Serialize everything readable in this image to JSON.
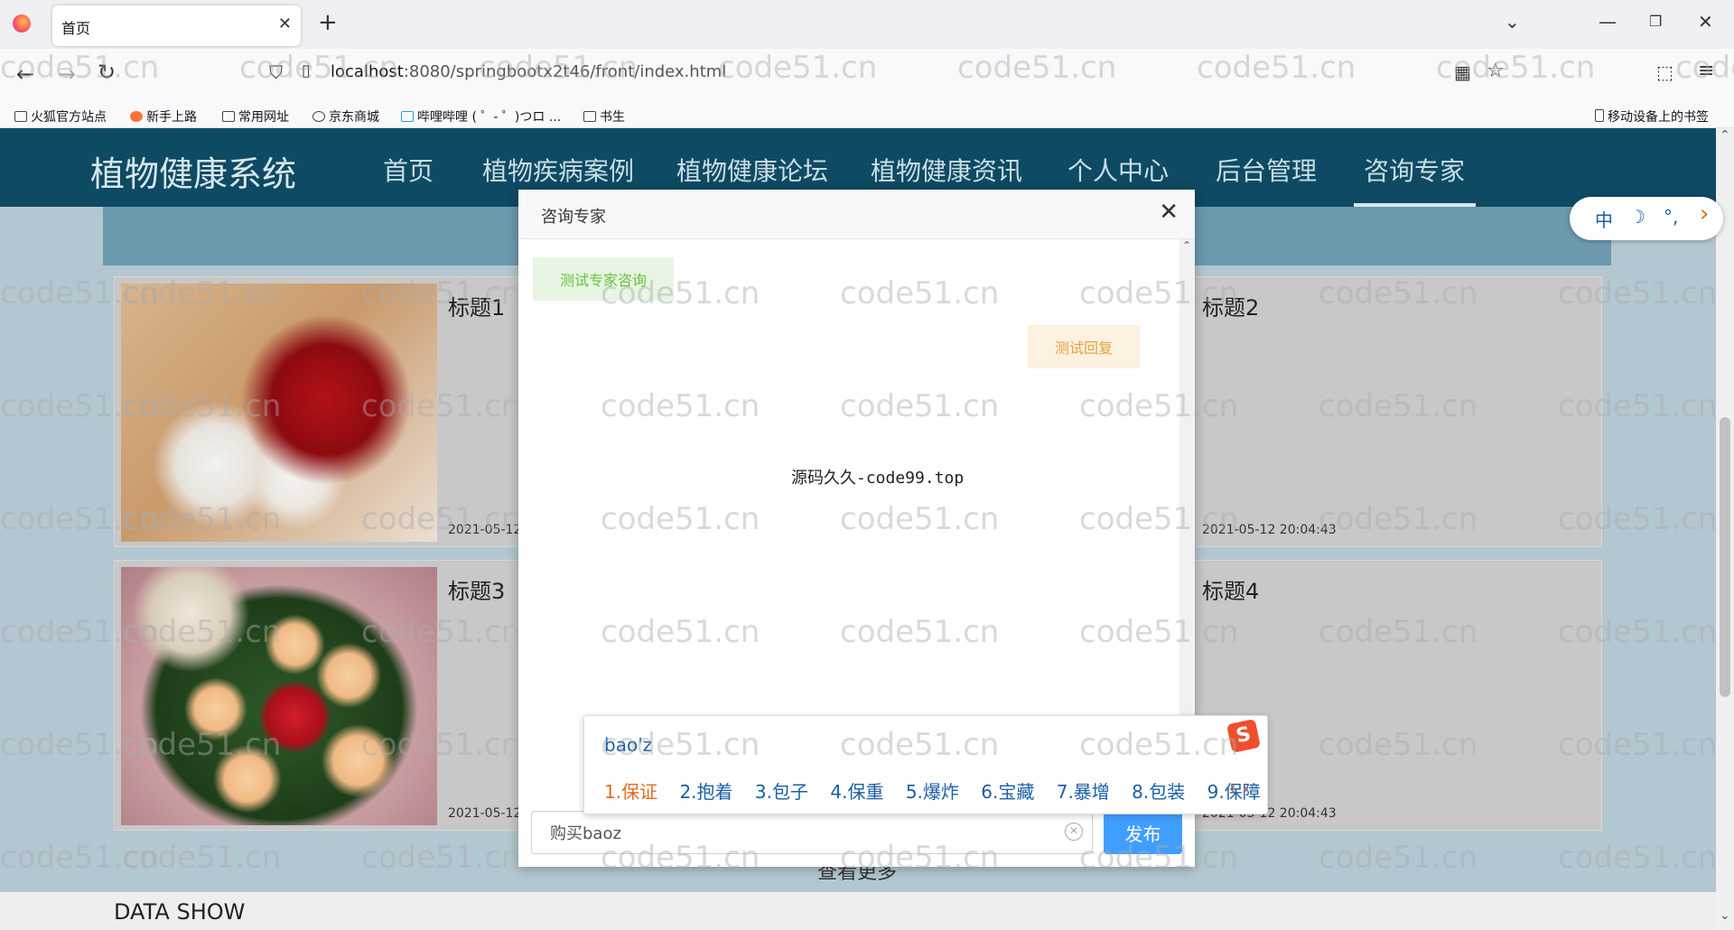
{
  "browser": {
    "tab_title": "首页",
    "tab_close": "✕",
    "new_tab": "+",
    "url_host": "localhost",
    "url_path": ":8080/springbootx2t46/front/index.html",
    "bookmarks": [
      "火狐官方站点",
      "新手上路",
      "常用网址",
      "京东商城",
      "哔哩哔哩 ( ゜- ゜)つロ ...",
      "书生"
    ],
    "mobile_bookmarks": "移动设备上的书签"
  },
  "site": {
    "title": "植物健康系统",
    "nav": [
      "首页",
      "植物疾病案例",
      "植物健康论坛",
      "植物健康资讯",
      "个人中心",
      "后台管理",
      "咨询专家"
    ]
  },
  "cards": [
    {
      "title": "标题1",
      "date": "2021-05-12"
    },
    {
      "title": "标题2",
      "date": "2021-05-12 20:04:43"
    },
    {
      "title": "标题3",
      "date": "2021-05-12"
    },
    {
      "title": "标题4",
      "date": "2021-05-12 20:04:43"
    }
  ],
  "more_label": "查看更多",
  "data_show": "DATA SHOW",
  "modal": {
    "title": "咨询专家",
    "close": "✕",
    "msg_user": "测试专家咨询",
    "msg_reply": "测试回复",
    "center_text": "源码久久-code99.top",
    "input_value": "购买baoz",
    "publish": "发布"
  },
  "ime": {
    "pinyin": "bao'z",
    "candidates": [
      "1.保证",
      "2.抱着",
      "3.包子",
      "4.保重",
      "5.爆炸",
      "6.宝藏",
      "7.暴增",
      "8.包装",
      "9.保障"
    ],
    "pager": "‹ ›",
    "logo": "S",
    "toolbar": [
      "中",
      "☽",
      "°,",
      "›"
    ]
  },
  "watermark": "code51.cn"
}
